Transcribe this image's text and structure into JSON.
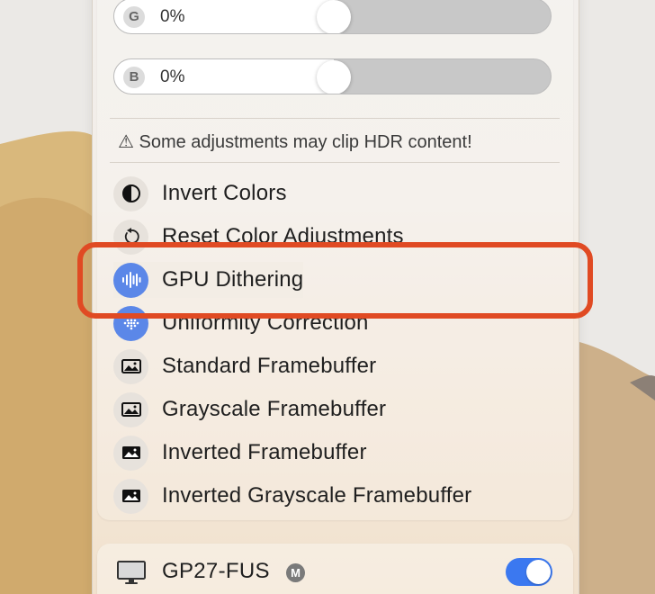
{
  "sliders": [
    {
      "badge": "G",
      "value": "0%",
      "level": 0.5
    },
    {
      "badge": "B",
      "value": "0%",
      "level": 0.5
    }
  ],
  "warning": "⚠︎ Some adjustments may clip HDR content!",
  "menu_items": [
    {
      "label": "Invert Colors",
      "icon": "half-circle-icon"
    },
    {
      "label": "Reset Color Adjustments",
      "icon": "reset-arrow-icon"
    },
    {
      "label": "GPU Dithering",
      "icon": "waveform-icon"
    },
    {
      "label": "Uniformity Correction",
      "icon": "dot-grid-icon"
    },
    {
      "label": "Standard Framebuffer",
      "icon": "photo-icon"
    },
    {
      "label": "Grayscale Framebuffer",
      "icon": "photo-icon"
    },
    {
      "label": "Inverted Framebuffer",
      "icon": "photo-inverted-icon"
    },
    {
      "label": "Inverted Grayscale Framebuffer",
      "icon": "photo-inverted-icon"
    }
  ],
  "display": {
    "name": "GP27-FUS",
    "badge": "M",
    "toggle_on": true,
    "icon": "monitor-icon"
  },
  "colors": {
    "accent_blue": "#5b87e8",
    "toggle_blue": "#3b78f0",
    "highlight": "#e04a23"
  }
}
